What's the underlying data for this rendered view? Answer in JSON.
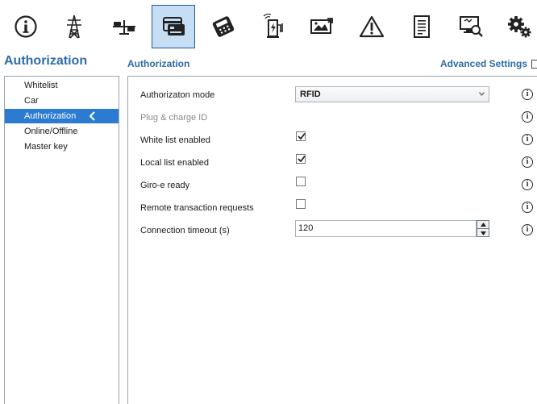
{
  "toolbar": {
    "items": [
      {
        "icon": "info-icon"
      },
      {
        "icon": "power-tower-icon"
      },
      {
        "icon": "balance-icon"
      },
      {
        "icon": "card-reader-icon",
        "active": true
      },
      {
        "icon": "payment-terminal-icon"
      },
      {
        "icon": "charging-station-icon"
      },
      {
        "icon": "display-image-icon"
      },
      {
        "icon": "warning-icon"
      },
      {
        "icon": "document-icon"
      },
      {
        "icon": "remote-diagnostics-icon"
      },
      {
        "icon": "settings-gears-icon"
      }
    ],
    "accent": "#1e5a98",
    "active_bg": "#c6def3"
  },
  "page_title": "Authorization",
  "section_title": "Authorization",
  "advanced_settings": {
    "label": "Advanced Settings",
    "checked": false
  },
  "sidebar": {
    "items": [
      {
        "label": "Whitelist"
      },
      {
        "label": "Car"
      },
      {
        "label": "Authorization",
        "active": true
      },
      {
        "label": "Online/Offline"
      },
      {
        "label": "Master key"
      }
    ],
    "active_color": "#2b7bd1"
  },
  "form": {
    "authorization_mode": {
      "label": "Authorizaton mode",
      "value": "RFID"
    },
    "plug_charge_id": {
      "label": "Plug & charge ID"
    },
    "white_list_enabled": {
      "label": "White list enabled",
      "checked": true
    },
    "local_list_enabled": {
      "label": "Local list enabled",
      "checked": true
    },
    "giro_e_ready": {
      "label": "Giro-e ready",
      "checked": false
    },
    "remote_transaction_requests": {
      "label": "Remote transaction requests",
      "checked": false
    },
    "connection_timeout": {
      "label": "Connection timeout (s)",
      "value": "120"
    },
    "info_glyph": "i"
  }
}
